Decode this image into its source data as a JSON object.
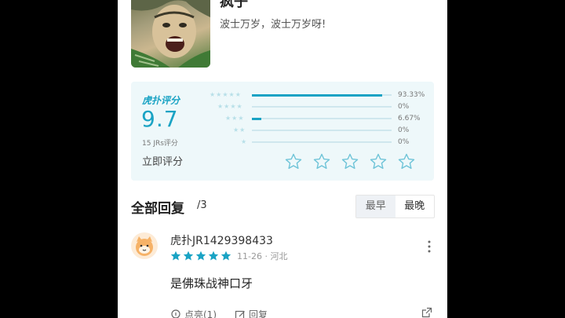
{
  "header": {
    "title": "疯子",
    "subtitle": "波士万岁，波士万岁呀!"
  },
  "rating": {
    "brand": "虎扑评分",
    "score": "9.7",
    "count_label": "15 JRs评分",
    "rate_now_label": "立即评分",
    "distribution": [
      {
        "stars": 5,
        "percent_label": "93.33%",
        "value": 93.33
      },
      {
        "stars": 4,
        "percent_label": "0%",
        "value": 0
      },
      {
        "stars": 3,
        "percent_label": "6.67%",
        "value": 6.67
      },
      {
        "stars": 2,
        "percent_label": "0%",
        "value": 0
      },
      {
        "stars": 1,
        "percent_label": "0%",
        "value": 0
      }
    ],
    "accent_color": "#1aa3c4"
  },
  "replies": {
    "title": "全部回复",
    "count": "/3",
    "sort_options": [
      "最早",
      "最晚"
    ],
    "sort_selected": "最早"
  },
  "comment": {
    "username": "虎扑JR1429398433",
    "stars": 5,
    "meta": "11-26 · 河北",
    "body": "是佛珠战神口牙",
    "like_label": "点亮(1)",
    "reply_label": "回复"
  }
}
